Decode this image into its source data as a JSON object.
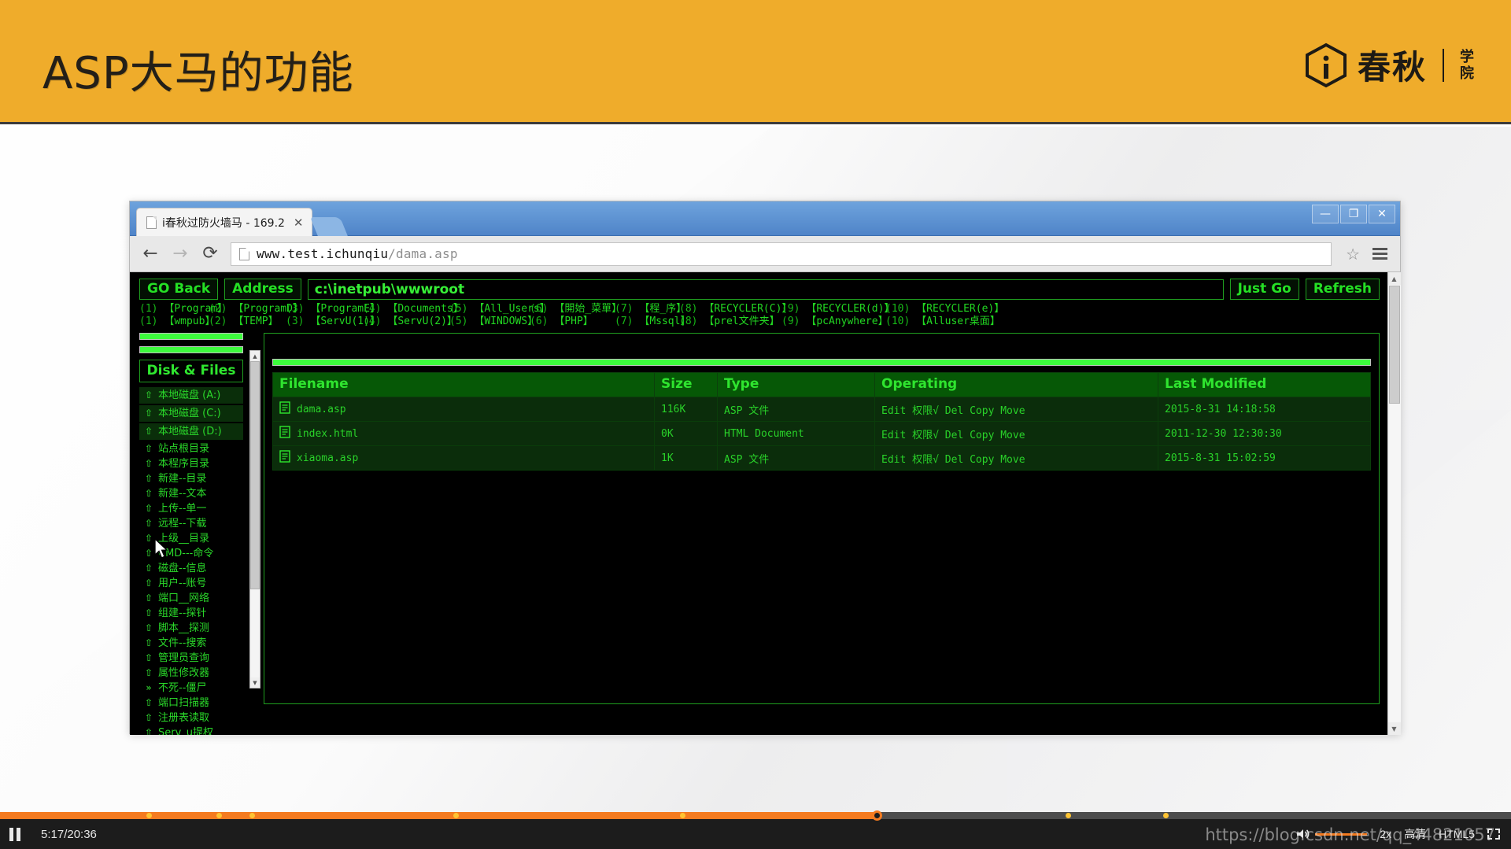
{
  "slide": {
    "title": "ASP大马的功能",
    "brand": {
      "name": "春秋",
      "sub_top": "学",
      "sub_bottom": "院",
      "mark": "i-hexagon-icon"
    }
  },
  "browser": {
    "tab": {
      "title": "i春秋过防火墙马 - 169.2",
      "close": "✕",
      "favicon": "page-icon"
    },
    "window_controls": {
      "minimize": "—",
      "restore": "❐",
      "close": "✕"
    },
    "nav": {
      "back": "←",
      "forward": "→",
      "reload": "⟳",
      "bookmark": "☆"
    },
    "url": {
      "host": "www.test.ichunqiu",
      "path": "/dama.asp"
    }
  },
  "shell": {
    "toolbar": {
      "go_back": "GO Back",
      "address_label": "Address",
      "address_value": "c:\\inetpub\\wwwroot",
      "just_go": "Just Go",
      "refresh": "Refresh"
    },
    "quicklinks": {
      "row1": [
        {
          "idx": "(1)",
          "label": "【Program】"
        },
        {
          "idx": "(2)",
          "label": "【ProgramD】"
        },
        {
          "idx": "(3)",
          "label": "【ProgramE】"
        },
        {
          "idx": "(4)",
          "label": "【Documents】"
        },
        {
          "idx": "(5)",
          "label": "【All_Users】"
        },
        {
          "idx": "(6)",
          "label": "【開始_菜單】"
        },
        {
          "idx": "(7)",
          "label": "【程_序】"
        },
        {
          "idx": "(8)",
          "label": "【RECYCLER(C)】"
        },
        {
          "idx": "(9)",
          "label": "【RECYCLER(d)】"
        },
        {
          "idx": "(10)",
          "label": "【RECYCLER(e)】"
        }
      ],
      "row2": [
        {
          "idx": "(1)",
          "label": "【wmpub】"
        },
        {
          "idx": "(2)",
          "label": "【TEMP】"
        },
        {
          "idx": "(3)",
          "label": "【ServU(1)】"
        },
        {
          "idx": "(4)",
          "label": "【ServU(2)】"
        },
        {
          "idx": "(5)",
          "label": "【WINDOWS】"
        },
        {
          "idx": "(6)",
          "label": "【PHP】"
        },
        {
          "idx": "(7)",
          "label": "【Mssql】"
        },
        {
          "idx": "(8)",
          "label": "【prel文件夹】"
        },
        {
          "idx": "(9)",
          "label": "【pcAnywhere】"
        },
        {
          "idx": "(10)",
          "label": "【Alluser桌面】"
        }
      ]
    },
    "sidebar": {
      "title": "Disk & Files",
      "drives": [
        {
          "icon": "folder-up-icon",
          "label": "本地磁盘 (A:)"
        },
        {
          "icon": "folder-up-icon",
          "label": "本地磁盘 (C:)"
        },
        {
          "icon": "folder-up-icon",
          "label": "本地磁盘 (D:)"
        }
      ],
      "items": [
        {
          "icon": "folder-up-icon",
          "label": "站点根目录"
        },
        {
          "icon": "folder-up-icon",
          "label": "本程序目录"
        },
        {
          "icon": "folder-up-icon",
          "label": "新建--目录"
        },
        {
          "icon": "folder-up-icon",
          "label": "新建--文本"
        },
        {
          "icon": "folder-up-icon",
          "label": "上传--单一"
        },
        {
          "icon": "folder-up-icon",
          "label": "远程--下载"
        },
        {
          "icon": "folder-up-icon",
          "label": "上级__目录"
        },
        {
          "icon": "folder-up-icon",
          "label": "CMD---命令"
        },
        {
          "icon": "folder-up-icon",
          "label": "磁盘--信息"
        },
        {
          "icon": "folder-up-icon",
          "label": "用户--账号"
        },
        {
          "icon": "folder-up-icon",
          "label": "端口__网络"
        },
        {
          "icon": "folder-up-icon",
          "label": "组建--探针"
        },
        {
          "icon": "folder-up-icon",
          "label": "脚本__探测"
        },
        {
          "icon": "folder-up-icon",
          "label": "文件--搜索"
        },
        {
          "icon": "folder-up-icon",
          "label": "管理员查询"
        },
        {
          "icon": "folder-up-icon",
          "label": "属性修改器"
        },
        {
          "icon": "double-arrow-icon",
          "label": "不死--僵尸"
        },
        {
          "icon": "folder-up-icon",
          "label": "端口扫描器"
        },
        {
          "icon": "folder-up-icon",
          "label": "注册表读取"
        },
        {
          "icon": "folder-up-icon",
          "label": "Serv_u提权"
        }
      ]
    },
    "files": {
      "headers": [
        "Filename",
        "Size",
        "Type",
        "Operating",
        "Last Modified"
      ],
      "rows": [
        {
          "icon": "file-icon",
          "filename": "dama.asp",
          "size": "116K",
          "type": "ASP 文件",
          "operating": "Edit 权限√ Del Copy Move",
          "modified": "2015-8-31 14:18:58"
        },
        {
          "icon": "file-icon",
          "filename": "index.html",
          "size": "0K",
          "type": "HTML Document",
          "operating": "Edit 权限√ Del Copy Move",
          "modified": "2011-12-30 12:30:30"
        },
        {
          "icon": "file-icon",
          "filename": "xiaoma.asp",
          "size": "1K",
          "type": "ASP 文件",
          "operating": "Edit 权限√ Del Copy Move",
          "modified": "2015-8-31 15:02:59"
        }
      ]
    }
  },
  "player": {
    "play_state": "pause-icon",
    "time": "5:17/20:36",
    "progress_percent": 58,
    "chapter_marks_percent": [
      9.7,
      14.3,
      16.5,
      30,
      45,
      70.5,
      77
    ],
    "volume_icon": "volume-icon",
    "speed": "2x",
    "quality": "高清",
    "player_type": "HTML5",
    "fullscreen": "fullscreen-icon"
  },
  "watermark": {
    "text": "https://blog.csdn.net/qq_44821057"
  },
  "colors": {
    "banner": "#efac2b",
    "shell_green": "#22d822",
    "accent_orange": "#f47b20",
    "titlebar_blue": "#4f84c8"
  }
}
